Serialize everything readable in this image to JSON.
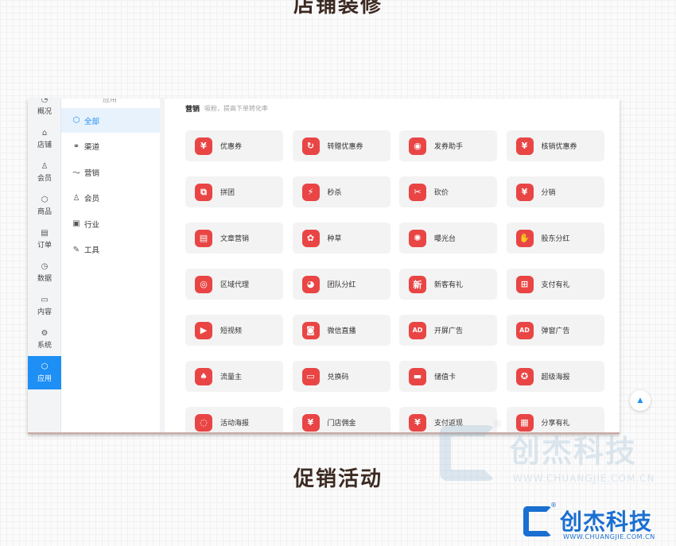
{
  "headings": {
    "top": "店铺装修",
    "bottom": "促销活动"
  },
  "rail": [
    {
      "label": "概况",
      "icon": "dashboard-icon",
      "glyph": "◔"
    },
    {
      "label": "店铺",
      "icon": "store-icon",
      "glyph": "⌂"
    },
    {
      "label": "会员",
      "icon": "user-icon",
      "glyph": "♙"
    },
    {
      "label": "商品",
      "icon": "box-icon",
      "glyph": "⬡"
    },
    {
      "label": "订单",
      "icon": "order-icon",
      "glyph": "▤"
    },
    {
      "label": "数据",
      "icon": "pie-icon",
      "glyph": "◷"
    },
    {
      "label": "内容",
      "icon": "folder-icon",
      "glyph": "▭"
    },
    {
      "label": "系统",
      "icon": "settings-icon",
      "glyph": "⚙"
    },
    {
      "label": "应用",
      "icon": "app-icon",
      "glyph": "⬡",
      "active": true
    }
  ],
  "submenu": {
    "top_partial": "应用",
    "items": [
      {
        "label": "全部",
        "icon": "cube-icon",
        "glyph": "⬡",
        "active": true
      },
      {
        "label": "渠道",
        "icon": "channel-icon",
        "glyph": "⚭"
      },
      {
        "label": "营销",
        "icon": "trend-icon",
        "glyph": "〜"
      },
      {
        "label": "会员",
        "icon": "user-icon",
        "glyph": "♙"
      },
      {
        "label": "行业",
        "icon": "shop-icon",
        "glyph": "▣"
      },
      {
        "label": "工具",
        "icon": "wrench-icon",
        "glyph": "✎"
      }
    ]
  },
  "section": {
    "title": "营销",
    "subtitle": "吸粉，提高下单转化率"
  },
  "cards": [
    {
      "label": "优惠券",
      "icon": "coupon-icon",
      "glyph": "¥"
    },
    {
      "label": "转赠优惠券",
      "icon": "transfer-coupon-icon",
      "glyph": "↻"
    },
    {
      "label": "发券助手",
      "icon": "coupon-helper-icon",
      "glyph": "◉"
    },
    {
      "label": "核销优惠券",
      "icon": "verify-coupon-icon",
      "glyph": "¥"
    },
    {
      "label": "拼团",
      "icon": "group-buy-icon",
      "glyph": "⧉"
    },
    {
      "label": "秒杀",
      "icon": "flash-icon",
      "glyph": "⚡"
    },
    {
      "label": "砍价",
      "icon": "bargain-icon",
      "glyph": "✂"
    },
    {
      "label": "分销",
      "icon": "money-bag-icon",
      "glyph": "¥"
    },
    {
      "label": "文章营销",
      "icon": "article-icon",
      "glyph": "▤"
    },
    {
      "label": "种草",
      "icon": "sprout-icon",
      "glyph": "✿"
    },
    {
      "label": "曝光台",
      "icon": "sun-icon",
      "glyph": "✺"
    },
    {
      "label": "股东分红",
      "icon": "share-dividend-icon",
      "glyph": "✋"
    },
    {
      "label": "区域代理",
      "icon": "region-agent-icon",
      "glyph": "◎"
    },
    {
      "label": "团队分红",
      "icon": "team-dividend-icon",
      "glyph": "◕"
    },
    {
      "label": "新客有礼",
      "icon": "new-customer-icon",
      "glyph": "新"
    },
    {
      "label": "支付有礼",
      "icon": "gift-icon",
      "glyph": "⊞"
    },
    {
      "label": "短视频",
      "icon": "video-icon",
      "glyph": "▶"
    },
    {
      "label": "微信直播",
      "icon": "live-icon",
      "glyph": "◙"
    },
    {
      "label": "开屏广告",
      "icon": "splash-ad-icon",
      "glyph": "AD"
    },
    {
      "label": "弹窗广告",
      "icon": "popup-ad-icon",
      "glyph": "AD"
    },
    {
      "label": "流量主",
      "icon": "traffic-icon",
      "glyph": "♠"
    },
    {
      "label": "兑换码",
      "icon": "redeem-code-icon",
      "glyph": "▭"
    },
    {
      "label": "储值卡",
      "icon": "card-icon",
      "glyph": "▬"
    },
    {
      "label": "超级海报",
      "icon": "super-poster-icon",
      "glyph": "✪"
    },
    {
      "label": "活动海报",
      "icon": "event-poster-icon",
      "glyph": "◌"
    },
    {
      "label": "门店佣金",
      "icon": "store-commission-icon",
      "glyph": "¥"
    },
    {
      "label": "支付返现",
      "icon": "cashback-icon",
      "glyph": "¥"
    },
    {
      "label": "分享有礼",
      "icon": "share-gift-icon",
      "glyph": "▦"
    }
  ],
  "scroll_top_icon": "arrow-up-icon",
  "watermark": {
    "name": "创杰科技",
    "reg": "®",
    "url": "WWW.CHUANGJIE.COM.CN"
  },
  "logo": {
    "name": "创杰科技",
    "reg": "®",
    "url": "WWW.CHUANGJIE.COM.CN"
  },
  "colors": {
    "accent": "#1e8ff5",
    "icon_red": "#e94545",
    "brand_blue": "#1a6fd1",
    "heading": "#3c2a22"
  }
}
